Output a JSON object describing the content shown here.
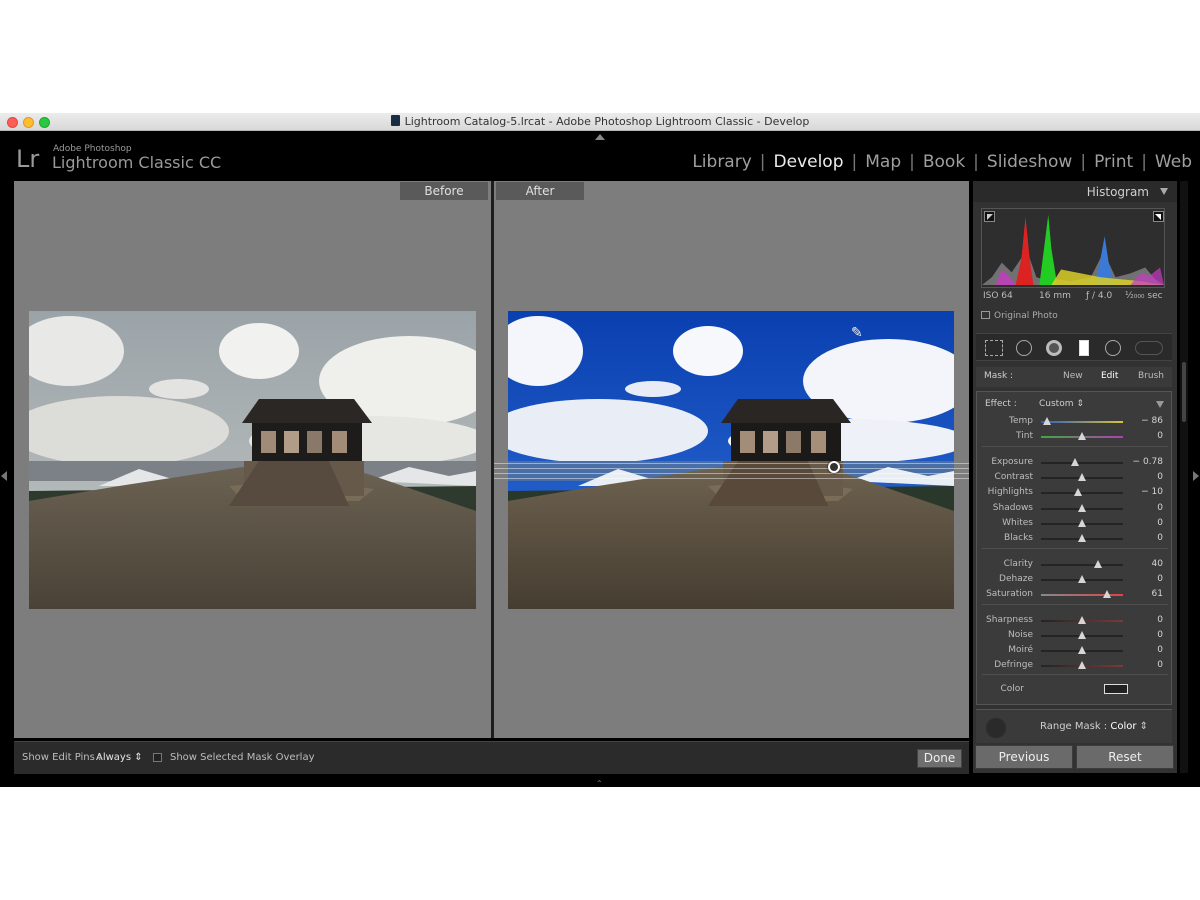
{
  "window": {
    "title": "Lightroom Catalog-5.lrcat - Adobe Photoshop Lightroom Classic - Develop"
  },
  "identity": {
    "logo": "Lr",
    "vendor": "Adobe Photoshop",
    "product": "Lightroom Classic CC"
  },
  "modules": [
    {
      "label": "Library",
      "active": false
    },
    {
      "label": "Develop",
      "active": true
    },
    {
      "label": "Map",
      "active": false
    },
    {
      "label": "Book",
      "active": false
    },
    {
      "label": "Slideshow",
      "active": false
    },
    {
      "label": "Print",
      "active": false
    },
    {
      "label": "Web",
      "active": false
    }
  ],
  "view": {
    "before_label": "Before",
    "after_label": "After"
  },
  "toolbar": {
    "edit_pins_label": "Show Edit Pins :",
    "edit_pins_value": "Always",
    "mask_overlay_label": "Show Selected Mask Overlay",
    "mask_overlay_checked": false,
    "done_label": "Done"
  },
  "panel": {
    "histogram_title": "Histogram",
    "exif": {
      "iso": "ISO 64",
      "focal": "16 mm",
      "aperture": "ƒ / 4.0",
      "shutter": "¹⁄₂₀₀₀ sec"
    },
    "original_photo_label": "Original Photo",
    "mask": {
      "label": "Mask :",
      "new": "New",
      "edit": "Edit",
      "brush": "Brush"
    },
    "effect": {
      "label": "Effect :",
      "value": "Custom"
    },
    "adjustments": [
      {
        "name": "Temp",
        "value": "− 86",
        "pos": -86
      },
      {
        "name": "Tint",
        "value": "0",
        "pos": 0
      },
      {
        "name": "Exposure",
        "value": "− 0.78",
        "pos": -16
      },
      {
        "name": "Contrast",
        "value": "0",
        "pos": 0
      },
      {
        "name": "Highlights",
        "value": "− 10",
        "pos": -10
      },
      {
        "name": "Shadows",
        "value": "0",
        "pos": 0
      },
      {
        "name": "Whites",
        "value": "0",
        "pos": 0
      },
      {
        "name": "Blacks",
        "value": "0",
        "pos": 0
      },
      {
        "name": "Clarity",
        "value": "40",
        "pos": 40
      },
      {
        "name": "Dehaze",
        "value": "0",
        "pos": 0
      },
      {
        "name": "Saturation",
        "value": "61",
        "pos": 61
      },
      {
        "name": "Sharpness",
        "value": "0",
        "pos": 0
      },
      {
        "name": "Noise",
        "value": "0",
        "pos": 0
      },
      {
        "name": "Moiré",
        "value": "0",
        "pos": 0
      },
      {
        "name": "Defringe",
        "value": "0",
        "pos": 0
      }
    ],
    "color_label": "Color",
    "range_mask": {
      "label": "Range Mask :",
      "value": "Color"
    },
    "previous_label": "Previous",
    "reset_label": "Reset"
  }
}
